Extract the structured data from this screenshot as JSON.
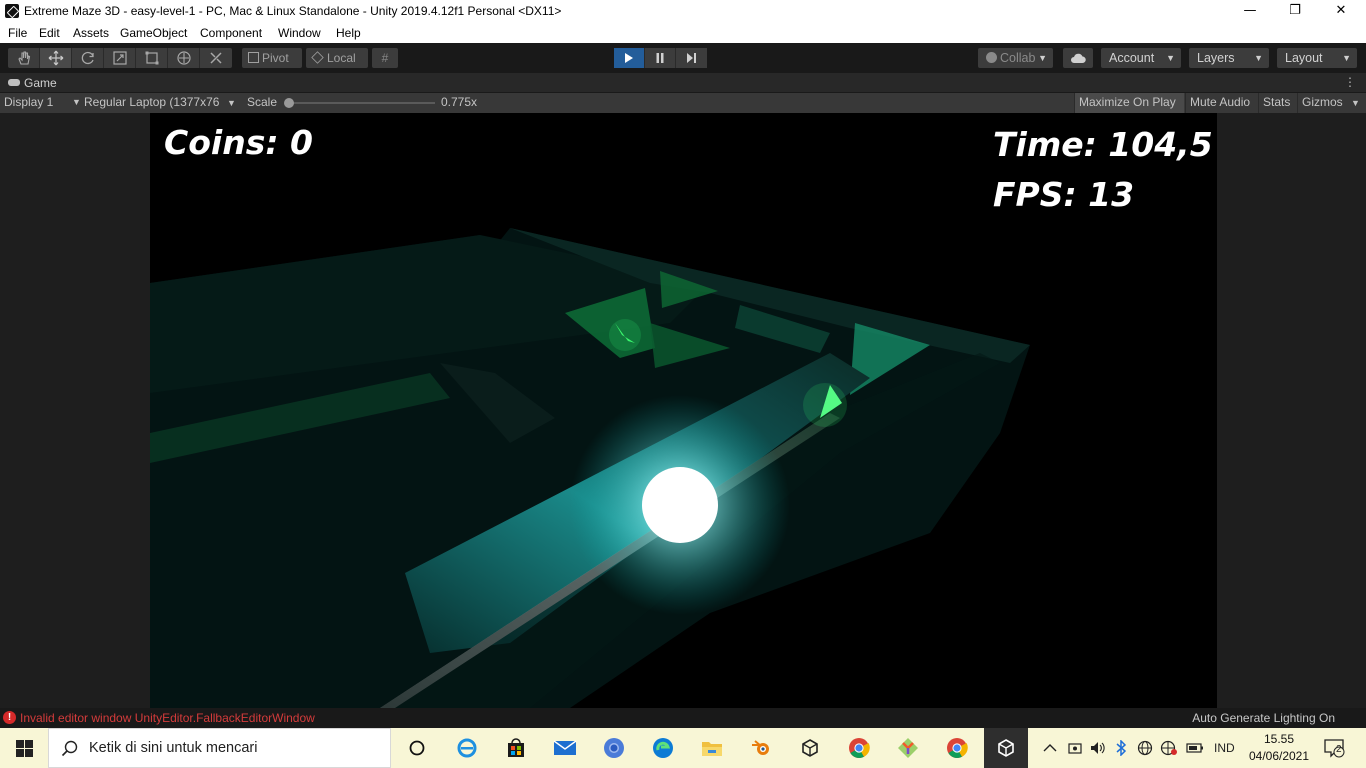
{
  "window": {
    "title": "Extreme Maze 3D - easy-level-1 - PC, Mac & Linux Standalone - Unity 2019.4.12f1 Personal <DX11>",
    "minimize": "—",
    "maximize": "❐",
    "close": "✕"
  },
  "menu": [
    "File",
    "Edit",
    "Assets",
    "GameObject",
    "Component",
    "Window",
    "Help"
  ],
  "toolbar": {
    "pivot_label": "Pivot",
    "local_label": "Local",
    "collab_label": "Collab",
    "account_label": "Account",
    "layers_label": "Layers",
    "layout_label": "Layout"
  },
  "game_tab": {
    "label": "Game",
    "display_label": "Display 1",
    "resolution_label": "Regular Laptop (1377x76",
    "scale_label": "Scale",
    "scale_value": "0.775x",
    "toggles": [
      "Maximize On Play",
      "Mute Audio",
      "Stats",
      "Gizmos"
    ]
  },
  "hud": {
    "coins": "Coins: 0",
    "time": "Time: 104,5",
    "fps": "FPS: 13"
  },
  "status": {
    "error_message": "Invalid editor window UnityEditor.FallbackEditorWindow",
    "lighting": "Auto Generate Lighting On"
  },
  "taskbar": {
    "search_placeholder": "Ketik di sini untuk mencari",
    "language": "IND",
    "time": "15.55",
    "date": "04/06/2021",
    "notifications": "2"
  },
  "colors": {
    "play_active": "#235d9a",
    "error_text": "#d43b3b",
    "editor_bg": "#191919",
    "taskbar_bg": "#f8f6d6"
  }
}
